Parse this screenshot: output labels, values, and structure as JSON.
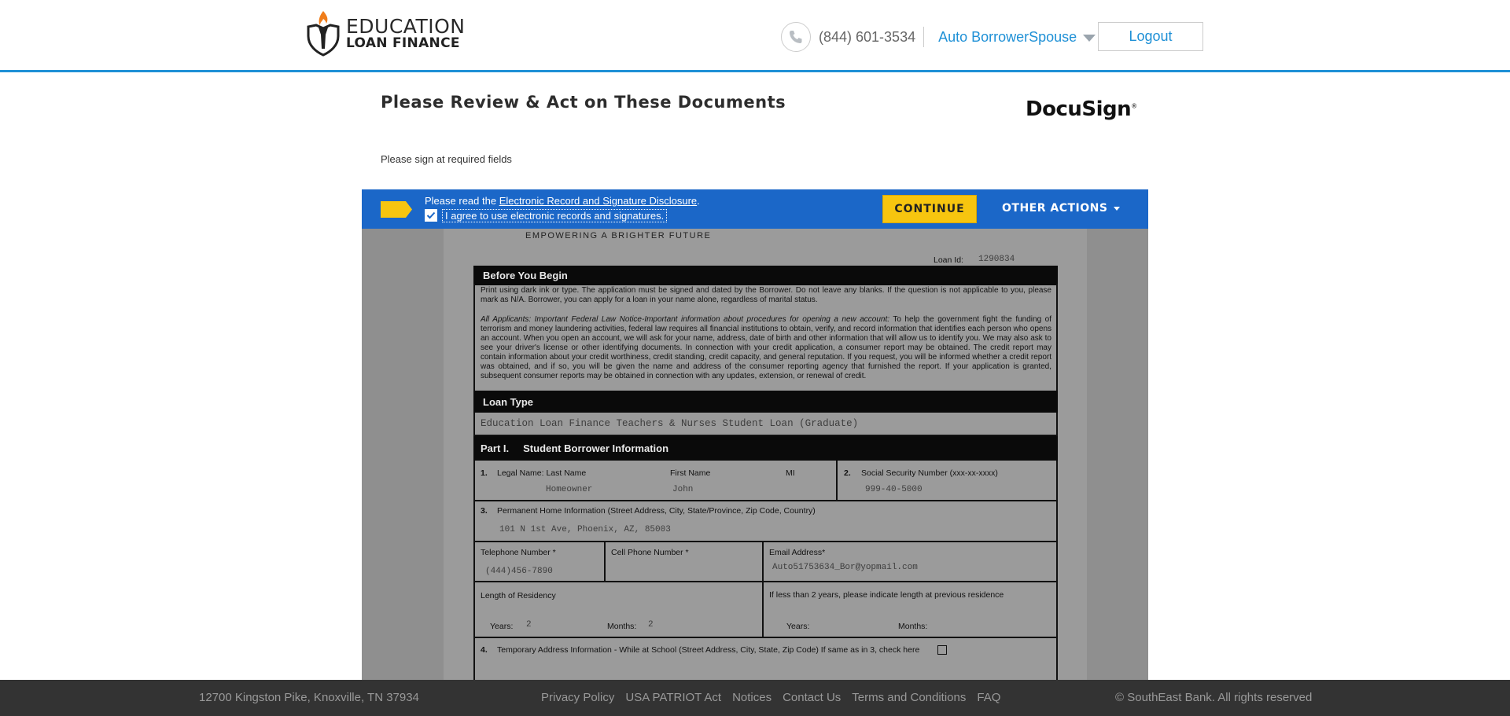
{
  "header": {
    "logo_line1": "EDUCATION",
    "logo_line2": "LOAN FINANCE",
    "phone": "(844) 601-3534",
    "user_name": "Auto BorrowerSpouse",
    "logout_label": "Logout"
  },
  "page": {
    "title": "Please Review & Act on These Documents",
    "docusign_brand": "DocuSign",
    "sign_note": "Please sign at required fields"
  },
  "banner": {
    "read_prefix": "Please read the ",
    "disclosure_link": "Electronic Record and Signature Disclosure",
    "read_suffix": ".",
    "agree_label": "I agree to use electronic records and signatures.",
    "agree_checked": true,
    "continue_label": "CONTINUE",
    "other_actions_label": "OTHER ACTIONS"
  },
  "document": {
    "tagline": "EMPOWERING A BRIGHTER FUTURE",
    "loan_id_label": "Loan Id:",
    "loan_id_value": "1290834",
    "before_you_begin_title": "Before You Begin",
    "before_you_begin_text": "Print using dark ink or type. The application must be signed and dated by the Borrower. Do not leave any blanks. If the question is not applicable to you, please mark as N/A. Borrower, you can apply for a loan in your name alone, regardless of marital status.",
    "notice_italic": "All Applicants: Important Federal Law Notice-Important information about procedures for opening a new account:",
    "notice_text": " To help the government fight the funding of terrorism and money laundering activities, federal law requires all financial institutions to obtain, verify, and record information that identifies each person who opens an account. When you open an account, we will ask for your name, address, date of birth and other information that will allow us to identify you. We may also ask to see your driver's license or other identifying documents. In connection with your credit application, a consumer report may be obtained. The credit report may contain information about your credit worthiness, credit standing, credit capacity, and general reputation. If you request, you will be informed whether a credit report was obtained, and if so, you will be given the name and address of the consumer reporting agency that furnished the report. If your application is granted, subsequent consumer reports may be obtained in connection with any updates, extension, or renewal of credit.",
    "loan_type_title": "Loan Type",
    "loan_type_value": "Education Loan Finance Teachers & Nurses Student Loan (Graduate)",
    "part1_label": "Part I.",
    "part1_title": "Student Borrower Information",
    "f1_num": "1.",
    "f1_label": "Legal Name: Last Name",
    "f1_first_label": "First Name",
    "f1_mi_label": "MI",
    "f1_last_value": "Homeowner",
    "f1_first_value": "John",
    "f2_num": "2.",
    "f2_label": "Social Security Number (xxx-xx-xxxx)",
    "f2_value": "999-40-5000",
    "f3_num": "3.",
    "f3_label": "Permanent Home Information (Street Address, City, State/Province, Zip Code, Country)",
    "f3_value": "101 N 1st Ave, Phoenix, AZ, 85003",
    "tel_label": "Telephone Number *",
    "tel_value": "(444)456-7890",
    "cell_label": "Cell Phone Number *",
    "email_label": "Email Address*",
    "email_value": "Auto51753634_Bor@yopmail.com",
    "residency_label": "Length of Residency",
    "years_label": "Years:",
    "years_value": "2",
    "months_label": "Months:",
    "months_value": "2",
    "prev_residence_label": "If less than 2 years, please indicate length at previous residence",
    "prev_years_label": "Years:",
    "prev_months_label": "Months:",
    "f4_num": "4.",
    "f4_label": "Temporary Address Information - While at School (Street Address, City, State, Zip Code) If same as in 3, check here"
  },
  "footer": {
    "address": "12700 Kingston Pike, Knoxville, TN 37934",
    "links": [
      "Privacy Policy",
      "USA PATRIOT Act",
      "Notices",
      "Contact Us",
      "Terms and Conditions",
      "FAQ"
    ],
    "copyright": "© SouthEast Bank. All rights reserved"
  }
}
